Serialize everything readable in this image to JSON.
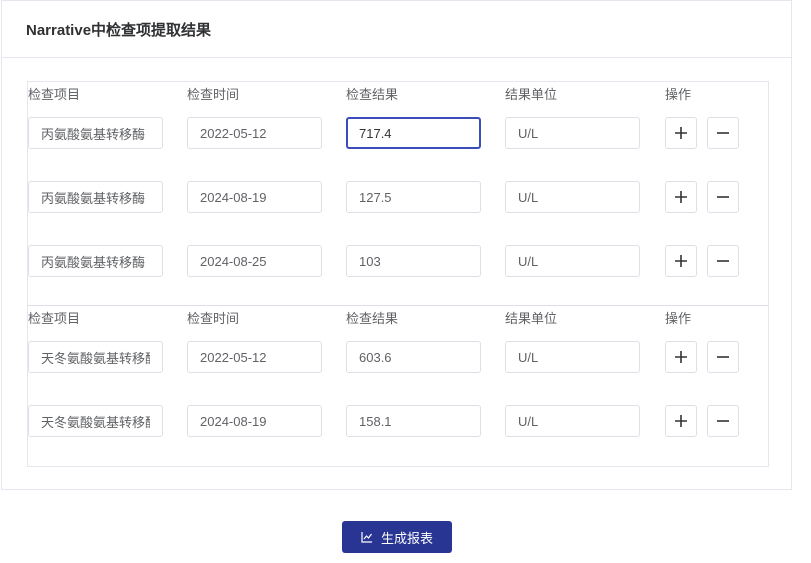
{
  "card": {
    "title": "Narrative中检查项提取结果"
  },
  "headers": {
    "item": "检查项目",
    "time": "检查时间",
    "result": "检查结果",
    "unit": "结果单位",
    "ops": "操作"
  },
  "groups": [
    {
      "rows": [
        {
          "item": "丙氨酸氨基转移酶",
          "time": "2022-05-12",
          "result": "717.4",
          "unit": "U/L"
        },
        {
          "item": "丙氨酸氨基转移酶",
          "time": "2024-08-19",
          "result": "127.5",
          "unit": "U/L"
        },
        {
          "item": "丙氨酸氨基转移酶",
          "time": "2024-08-25",
          "result": "103",
          "unit": "U/L"
        }
      ]
    },
    {
      "rows": [
        {
          "item": "天冬氨酸氨基转移酶",
          "time": "2022-05-12",
          "result": "603.6",
          "unit": "U/L"
        },
        {
          "item": "天冬氨酸氨基转移酶",
          "time": "2024-08-19",
          "result": "158.1",
          "unit": "U/L"
        }
      ]
    }
  ],
  "icons": {
    "add": "plus-icon",
    "delete": "minus-icon",
    "report": "line-chart-icon"
  },
  "colors": {
    "primary": "#283593",
    "focus_border": "#3b4db8",
    "border": "#dcdfe6"
  },
  "actions": {
    "generate_report": "生成报表"
  }
}
